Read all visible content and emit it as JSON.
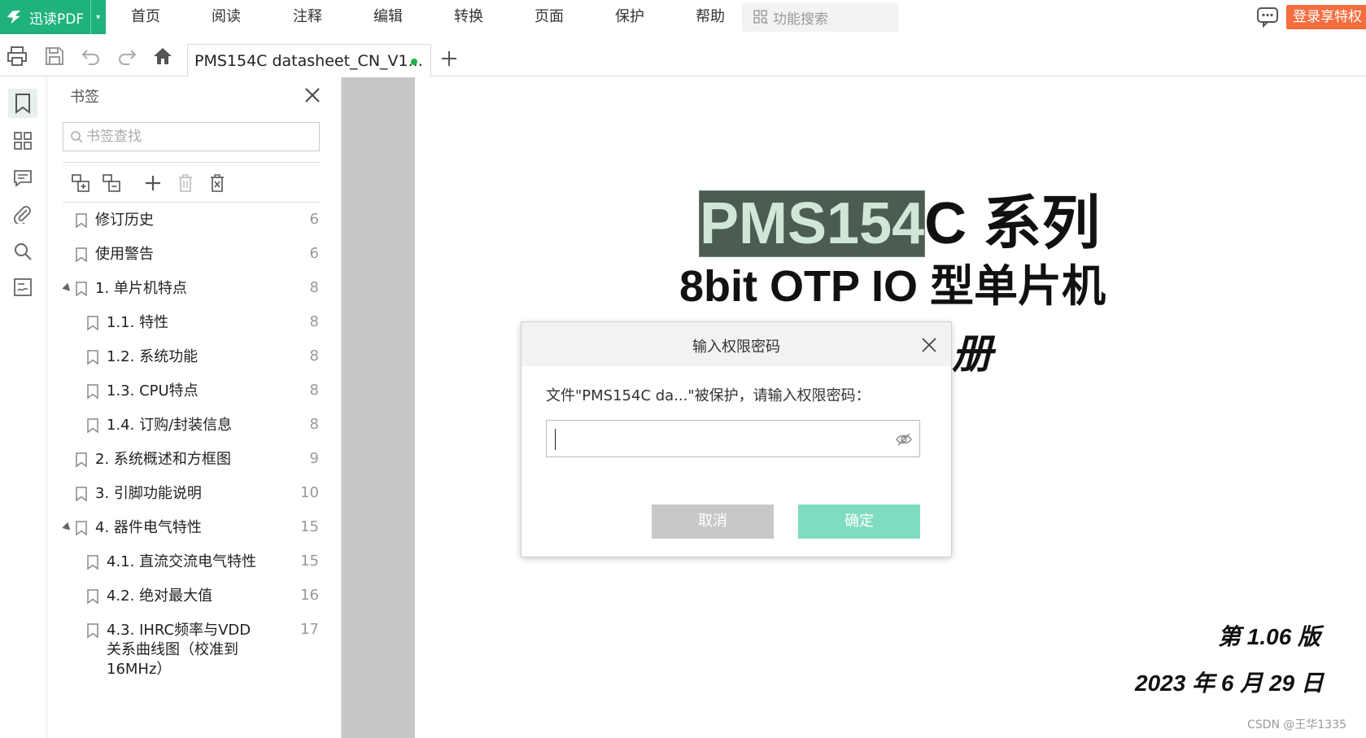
{
  "menubar": {
    "brand": "迅读PDF",
    "items": [
      "首页",
      "阅读",
      "注释",
      "编辑",
      "转换",
      "页面",
      "保护",
      "帮助"
    ],
    "search_placeholder": "功能搜索",
    "login_label": "登录享特权"
  },
  "toolbar": {
    "tab_title": "PMS154C datasheet_CN_V1...",
    "tab_status_color": "#22b14c"
  },
  "bookmarks": {
    "title": "书签",
    "search_placeholder": "书签查找",
    "items": [
      {
        "label": "修订历史",
        "page": "6",
        "level": 0,
        "expandable": false
      },
      {
        "label": "使用警告",
        "page": "6",
        "level": 0,
        "expandable": false
      },
      {
        "label": "1.  单片机特点",
        "page": "8",
        "level": 0,
        "expandable": true
      },
      {
        "label": "1.1. 特性",
        "page": "8",
        "level": 1,
        "expandable": false
      },
      {
        "label": "1.2. 系统功能",
        "page": "8",
        "level": 1,
        "expandable": false
      },
      {
        "label": "1.3. CPU特点",
        "page": "8",
        "level": 1,
        "expandable": false
      },
      {
        "label": "1.4. 订购/封装信息",
        "page": "8",
        "level": 1,
        "expandable": false
      },
      {
        "label": "2.  系统概述和方框图",
        "page": "9",
        "level": 0,
        "expandable": false
      },
      {
        "label": "3.  引脚功能说明",
        "page": "10",
        "level": 0,
        "expandable": false
      },
      {
        "label": "4. 器件电气特性",
        "page": "15",
        "level": 0,
        "expandable": true
      },
      {
        "label": "4.1. 直流交流电气特性",
        "page": "15",
        "level": 1,
        "expandable": false
      },
      {
        "label": "4.2. 绝对最大值",
        "page": "16",
        "level": 1,
        "expandable": false
      },
      {
        "label": "4.3.  IHRC频率与VDD关系曲线图（校准到16MHz）",
        "page": "17",
        "level": 1,
        "expandable": false
      }
    ]
  },
  "document": {
    "title_highlighted": "PMS154",
    "title_rest": "C 系列",
    "subtitle": "8bit OTP IO 型单片机",
    "subtitle2_partial": "册",
    "version": "第 1.06 版",
    "date": "2023 年 6 月 29 日",
    "watermark": "CSDN @王华1335"
  },
  "dialog": {
    "title": "输入权限密码",
    "message": "文件\"PMS154C da...\"被保护，请输入权限密码：",
    "password_value": "",
    "cancel_label": "取消",
    "ok_label": "确定"
  }
}
